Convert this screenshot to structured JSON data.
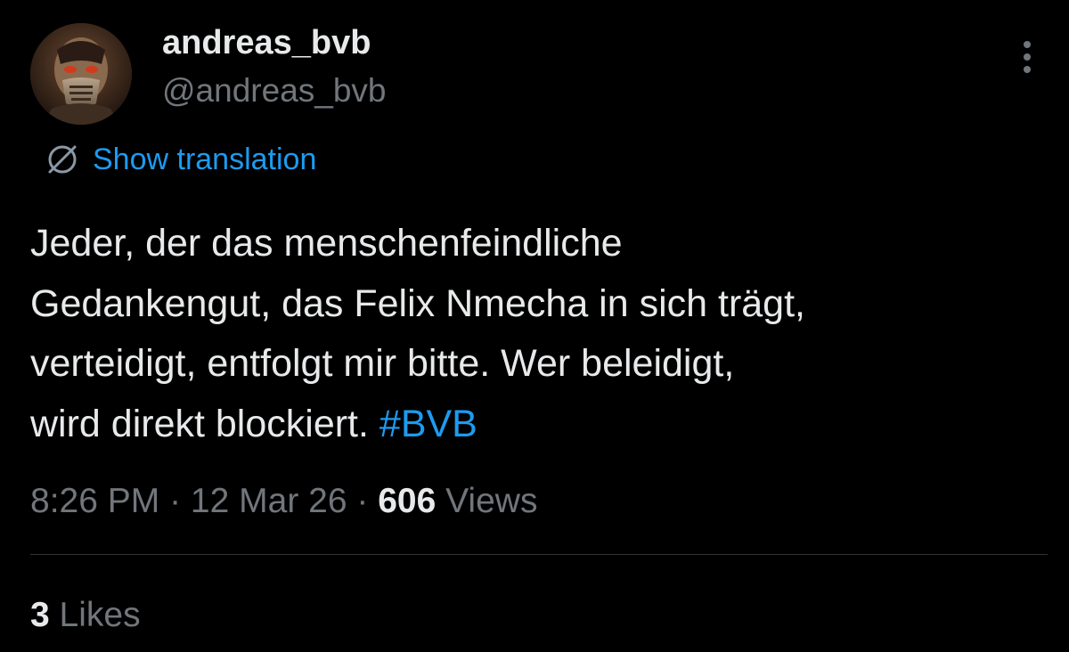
{
  "author": {
    "display_name": "andreas_bvb",
    "handle": "@andreas_bvb",
    "avatar_icon": "masked-face-avatar"
  },
  "menu": {
    "icon": "more-vertical-icon"
  },
  "translation": {
    "icon": "globe-translate-icon",
    "label": "Show translation"
  },
  "tweet": {
    "lines": [
      "Jeder, der das menschenfeindliche",
      "Gedankengut, das Felix Nmecha in sich trägt,",
      "verteidigt, entfolgt mir bitte. Wer beleidigt,",
      "wird direkt blockiert. "
    ],
    "hashtag": "#BVB"
  },
  "meta": {
    "time": "8:26 PM",
    "separator": " · ",
    "date": "12 Mar 26",
    "views_count": "606",
    "views_label": " Views"
  },
  "engagement": {
    "likes_count": "3",
    "likes_label": " Likes"
  },
  "colors": {
    "background": "#000000",
    "primary_text": "#e7e9ea",
    "secondary_text": "#71767b",
    "accent": "#1d9bf0",
    "divider": "#2f3336"
  }
}
